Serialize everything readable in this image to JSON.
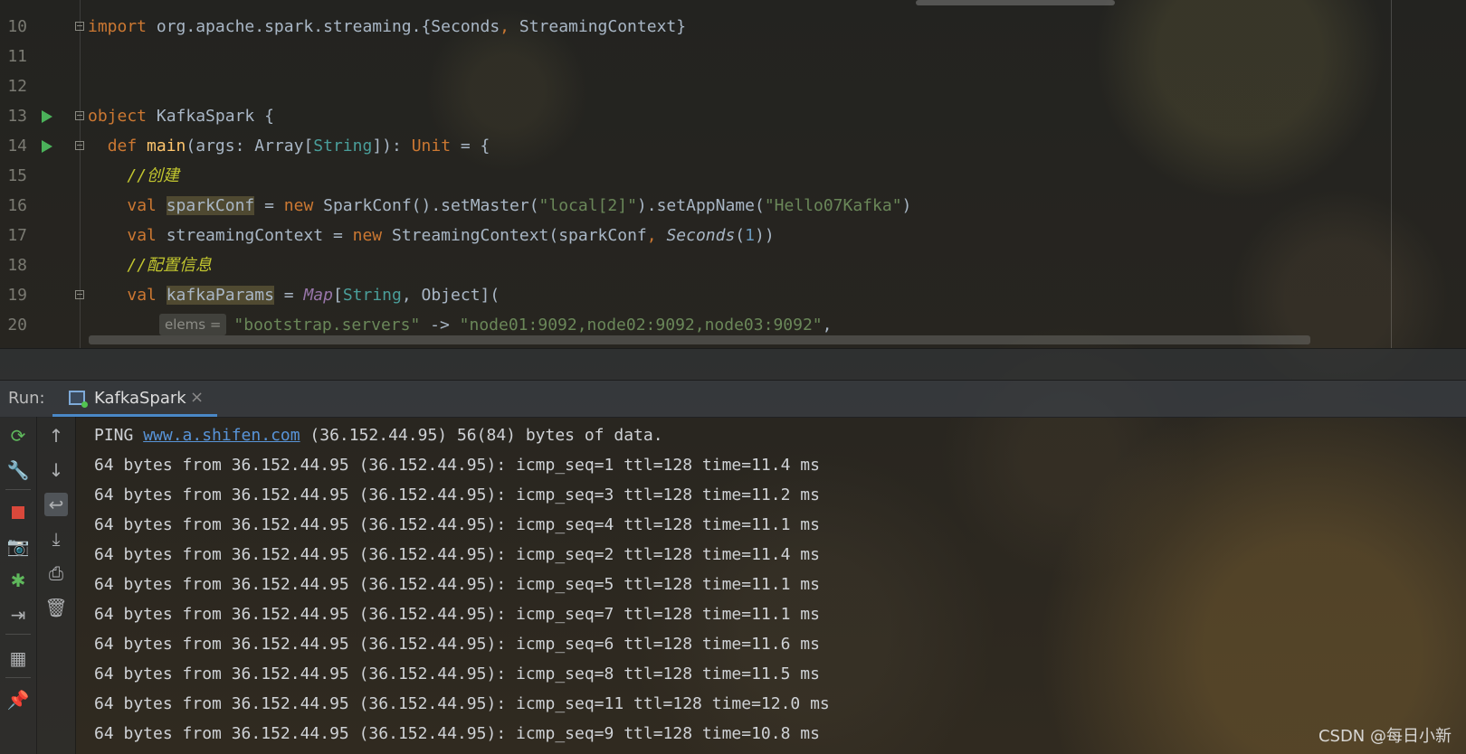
{
  "editor": {
    "lines": [
      {
        "num": "10",
        "parts": [
          {
            "t": "import",
            "c": "kw"
          },
          {
            "t": " org.apache.spark.streaming.{Seconds"
          },
          {
            "t": ",",
            "c": "kw"
          },
          {
            "t": " StreamingContext}"
          }
        ]
      },
      {
        "num": "11",
        "parts": []
      },
      {
        "num": "12",
        "parts": []
      },
      {
        "num": "13",
        "parts": [
          {
            "t": "object",
            "c": "kw"
          },
          {
            "t": " KafkaSpark {"
          }
        ]
      },
      {
        "num": "14",
        "parts": [
          {
            "t": "  "
          },
          {
            "t": "def",
            "c": "kw"
          },
          {
            "t": " "
          },
          {
            "t": "main",
            "c": "fn"
          },
          {
            "t": "(args: Array["
          },
          {
            "t": "String",
            "c": "typ"
          },
          {
            "t": "]): "
          },
          {
            "t": "Unit",
            "c": "kw"
          },
          {
            "t": " = {"
          }
        ]
      },
      {
        "num": "15",
        "parts": [
          {
            "t": "    "
          },
          {
            "t": "//创建",
            "c": "cmt"
          }
        ]
      },
      {
        "num": "16",
        "parts": [
          {
            "t": "    "
          },
          {
            "t": "val",
            "c": "kw"
          },
          {
            "t": " "
          },
          {
            "t": "sparkConf",
            "c": "hl"
          },
          {
            "t": " = "
          },
          {
            "t": "new",
            "c": "kw"
          },
          {
            "t": " SparkConf().setMaster("
          },
          {
            "t": "\"local[2]\"",
            "c": "str"
          },
          {
            "t": ").setAppName("
          },
          {
            "t": "\"Hello07Kafka\"",
            "c": "str"
          },
          {
            "t": ")"
          }
        ]
      },
      {
        "num": "17",
        "parts": [
          {
            "t": "    "
          },
          {
            "t": "val",
            "c": "kw"
          },
          {
            "t": " streamingContext = "
          },
          {
            "t": "new",
            "c": "kw"
          },
          {
            "t": " StreamingContext(sparkConf"
          },
          {
            "t": ",",
            "c": "kw"
          },
          {
            "t": " "
          },
          {
            "t": "Seconds",
            "c": "itl"
          },
          {
            "t": "("
          },
          {
            "t": "1",
            "c": "num"
          },
          {
            "t": "))"
          }
        ]
      },
      {
        "num": "18",
        "parts": [
          {
            "t": "    "
          },
          {
            "t": "//配置信息",
            "c": "cmt"
          }
        ]
      },
      {
        "num": "19",
        "parts": [
          {
            "t": "    "
          },
          {
            "t": "val",
            "c": "kw"
          },
          {
            "t": " "
          },
          {
            "t": "kafkaParams",
            "c": "hl"
          },
          {
            "t": " = "
          },
          {
            "t": "Map",
            "c": "map"
          },
          {
            "t": "["
          },
          {
            "t": "String",
            "c": "typ"
          },
          {
            "t": ", Object]("
          }
        ]
      },
      {
        "num": "20",
        "hint": "elems =",
        "parts": [
          {
            "t": "\"bootstrap.servers\"",
            "c": "str"
          },
          {
            "t": " -> "
          },
          {
            "t": "\"node01:9092,node02:9092,node03:9092\"",
            "c": "str"
          },
          {
            "t": ","
          }
        ]
      }
    ]
  },
  "run": {
    "label": "Run:",
    "tab": {
      "name": "KafkaSpark",
      "close": "×"
    }
  },
  "console": {
    "ping_prefix": "PING ",
    "ping_host": "www.a.shifen.com",
    "ping_suffix": " (36.152.44.95) 56(84) bytes of data.",
    "lines": [
      "64 bytes from 36.152.44.95 (36.152.44.95): icmp_seq=1 ttl=128 time=11.4 ms",
      "64 bytes from 36.152.44.95 (36.152.44.95): icmp_seq=3 ttl=128 time=11.2 ms",
      "64 bytes from 36.152.44.95 (36.152.44.95): icmp_seq=4 ttl=128 time=11.1 ms",
      "64 bytes from 36.152.44.95 (36.152.44.95): icmp_seq=2 ttl=128 time=11.4 ms",
      "64 bytes from 36.152.44.95 (36.152.44.95): icmp_seq=5 ttl=128 time=11.1 ms",
      "64 bytes from 36.152.44.95 (36.152.44.95): icmp_seq=7 ttl=128 time=11.1 ms",
      "64 bytes from 36.152.44.95 (36.152.44.95): icmp_seq=6 ttl=128 time=11.6 ms",
      "64 bytes from 36.152.44.95 (36.152.44.95): icmp_seq=8 ttl=128 time=11.5 ms",
      "64 bytes from 36.152.44.95 (36.152.44.95): icmp_seq=11 ttl=128 time=12.0 ms",
      "64 bytes from 36.152.44.95 (36.152.44.95): icmp_seq=9 ttl=128 time=10.8 ms"
    ]
  },
  "toolbar": {
    "left": [
      "rerun-icon",
      "wrench-icon",
      "stop-icon",
      "camera-icon",
      "debug-icon",
      "exit-icon",
      "layout-icon",
      "pin-icon"
    ],
    "right": [
      "up-arrow-icon",
      "down-arrow-icon",
      "soft-wrap-icon",
      "scroll-to-end-icon",
      "print-icon",
      "trash-icon"
    ]
  },
  "colors": {
    "keyword": "#cc7832",
    "string": "#6a8759",
    "comment": "#c2c62f",
    "link": "#5894d8",
    "accent": "#4a88c7"
  },
  "watermark": "CSDN @每日小新"
}
